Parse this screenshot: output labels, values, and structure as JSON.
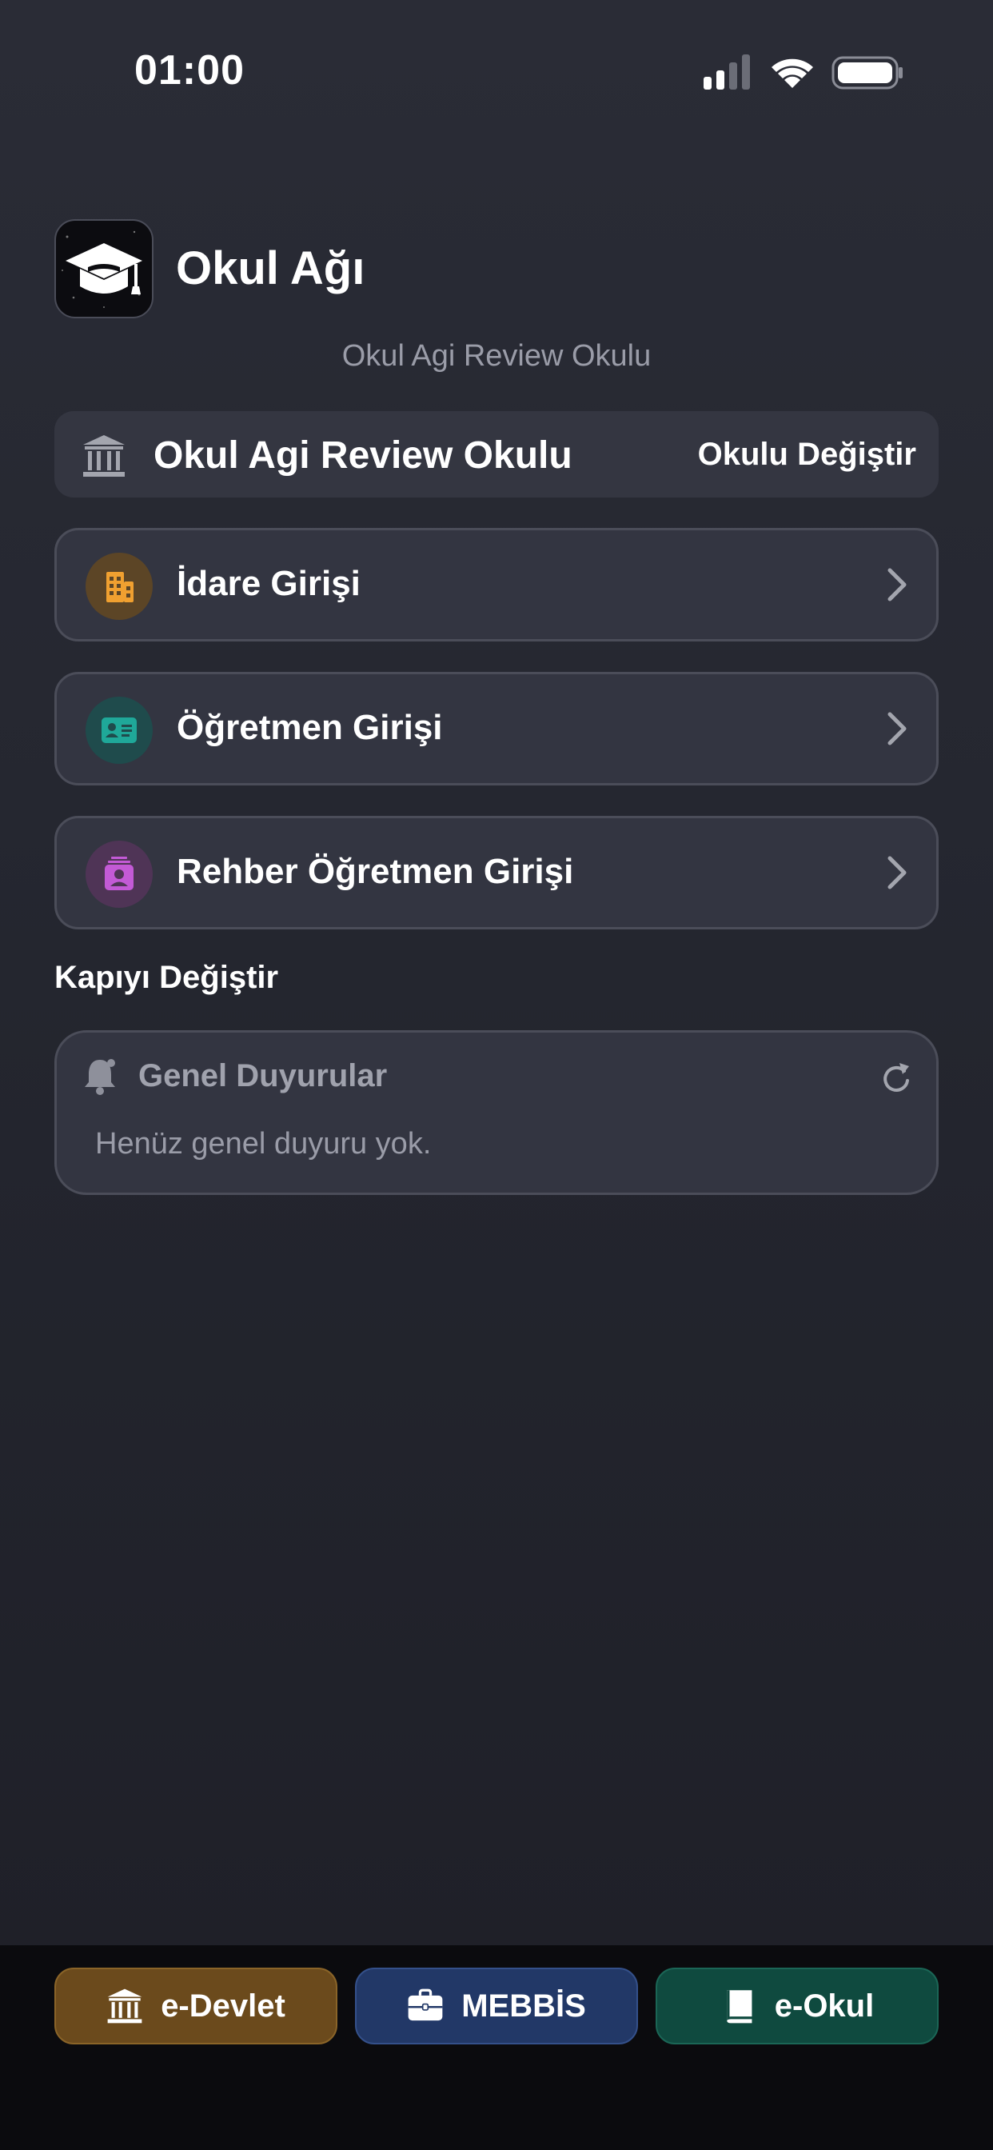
{
  "status_bar": {
    "time": "01:00"
  },
  "header": {
    "app_title": "Okul Ağı",
    "school_subtitle": "Okul Agi Review Okulu"
  },
  "school_selector": {
    "school_name": "Okul Agi Review Okulu",
    "change_label": "Okulu Değiştir"
  },
  "login_options": [
    {
      "label": "İdare Girişi",
      "icon": "building-icon",
      "color": "#f0a030"
    },
    {
      "label": "Öğretmen Girişi",
      "icon": "id-card-icon",
      "color": "#1fa899"
    },
    {
      "label": "Rehber Öğretmen Girişi",
      "icon": "badge-icon",
      "color": "#c35ad6"
    }
  ],
  "gate_section": {
    "label": "Kapıyı Değiştir"
  },
  "announcements": {
    "title": "Genel Duyurular",
    "empty_text": "Henüz genel duyuru yok."
  },
  "quick_links": [
    {
      "label": "e-Devlet",
      "icon": "bank-icon",
      "color": "#6b4a1c"
    },
    {
      "label": "MEBBİS",
      "icon": "briefcase-icon",
      "color": "#223867"
    },
    {
      "label": "e-Okul",
      "icon": "book-icon",
      "color": "#0f4a3f"
    }
  ]
}
